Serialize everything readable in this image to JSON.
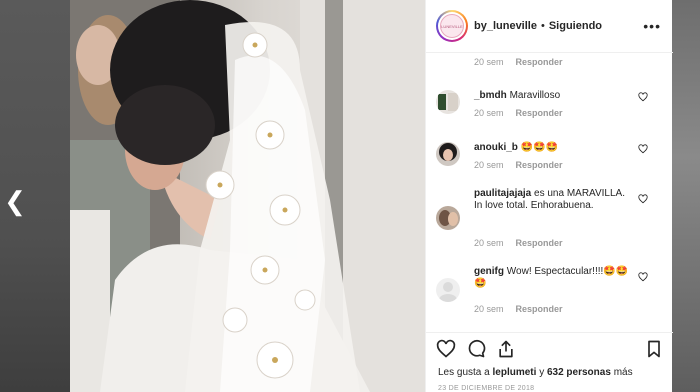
{
  "post": {
    "username": "by_luneville",
    "separator": "•",
    "follow_status": "Siguiendo",
    "avatar_logo_text": "LUNEVILLE"
  },
  "top_meta": {
    "time": "20 sem",
    "reply": "Responder"
  },
  "comments": [
    {
      "user": "_bmdh",
      "text": "Maravilloso",
      "time": "20 sem",
      "reply": "Responder"
    },
    {
      "user": "anouki_b",
      "text": "🤩🤩🤩",
      "time": "20 sem",
      "reply": "Responder"
    },
    {
      "user": "paulitajajaja",
      "text": "es una MARAVILLA. In love total. Enhorabuena.",
      "time": "20 sem",
      "reply": "Responder"
    },
    {
      "user": "genifg",
      "text": "Wow! Espectacular!!!!🤩🤩🤩",
      "time": "20 sem",
      "reply": "Responder"
    }
  ],
  "likes": {
    "prefix": "Les gusta a",
    "user": "leplumeti",
    "and": "y",
    "count": "632 personas",
    "suffix": "más"
  },
  "date": "23 DE DICIEMBRE DE 2018",
  "colors": {
    "text": "#262626",
    "muted": "#999999",
    "border": "#efefef"
  }
}
